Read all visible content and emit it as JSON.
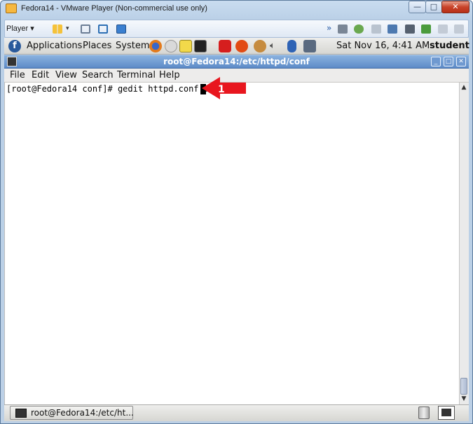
{
  "vmware": {
    "title": "Fedora14 - VMware Player (Non-commercial use only)",
    "minimize": "—",
    "maximize": "□",
    "close": "✕",
    "player_label": "Player ▾"
  },
  "panel": {
    "applications": "Applications",
    "places": "Places",
    "system": "System",
    "datetime": "Sat Nov 16,  4:41 AM",
    "user": "student"
  },
  "terminal": {
    "title": "root@Fedora14:/etc/httpd/conf",
    "menu": [
      "File",
      "Edit",
      "View",
      "Search",
      "Terminal",
      "Help"
    ],
    "prompt_line": "[root@Fedora14 conf]# gedit httpd.conf & "
  },
  "callout": {
    "number": "1",
    "color": "#e8161e"
  },
  "taskbar": {
    "task_label": "root@Fedora14:/etc/ht..."
  }
}
